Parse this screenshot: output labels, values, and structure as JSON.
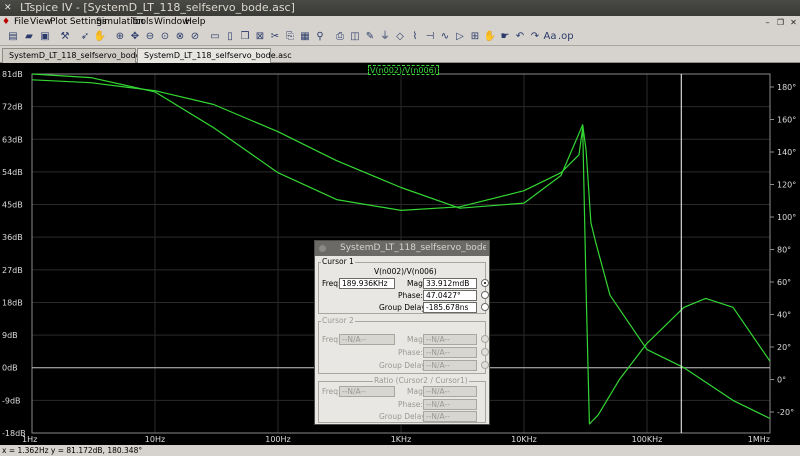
{
  "window": {
    "title": "LTspice IV - [SystemD_LT_118_selfservo_bode.asc]"
  },
  "menu": [
    "File",
    "View",
    "Plot Settings",
    "Simulation",
    "Tools",
    "Window",
    "Help"
  ],
  "tabs": [
    {
      "label": "SystemD_LT_118_selfservo_bode.asc",
      "active": false
    },
    {
      "label": "SystemD_LT_118_selfservo_bode.asc",
      "active": true
    }
  ],
  "plot": {
    "expression": "V(n002)/V(n006)",
    "colors": {
      "background": "#000000",
      "trace": "#33d633",
      "grid": "#2a2a2a",
      "axis_text": "#dcdcdc",
      "cursor": "#ffffff"
    },
    "left_ticks": [
      "81dB",
      "72dB",
      "63dB",
      "54dB",
      "45dB",
      "36dB",
      "27dB",
      "18dB",
      "9dB",
      "0dB",
      "-9dB",
      "-18dB"
    ],
    "right_ticks": [
      "180°",
      "160°",
      "140°",
      "120°",
      "100°",
      "80°",
      "60°",
      "40°",
      "20°",
      "0°",
      "-20°"
    ],
    "x_ticks": [
      "1Hz",
      "10Hz",
      "100Hz",
      "1KHz",
      "10KHz",
      "100KHz",
      "1MHz"
    ]
  },
  "chart_data": {
    "type": "line",
    "title": "V(n002)/V(n006)",
    "x_scale": "log",
    "xlim_hz": [
      1,
      1000000
    ],
    "ylim_left_db": [
      -18,
      81
    ],
    "ylim_right_deg": [
      -20,
      180
    ],
    "series": [
      {
        "name": "magnitude",
        "axis": "left",
        "unit": "dB",
        "x_hz": [
          1,
          3,
          10,
          30,
          100,
          300,
          1000,
          3000,
          10000,
          20000,
          30000,
          32000,
          35000,
          38000,
          50000,
          100000,
          200000,
          500000,
          1000000
        ],
        "y": [
          79.4,
          78.6,
          76.4,
          72.6,
          65.1,
          57.1,
          49.7,
          44.0,
          45.4,
          53.0,
          67.0,
          60.0,
          40.0,
          35.0,
          20.0,
          5.0,
          0.0,
          -9.0,
          -14.0
        ]
      },
      {
        "name": "phase",
        "axis": "right",
        "unit": "deg",
        "x_hz": [
          1,
          3,
          10,
          30,
          100,
          300,
          1000,
          3000,
          10000,
          20000,
          28000,
          30000,
          32000,
          34000,
          40000,
          60000,
          100000,
          200000,
          300000,
          500000,
          1000000
        ],
        "y": [
          180,
          178,
          170,
          150,
          125,
          110,
          104,
          106,
          115,
          125,
          135,
          150,
          60,
          -15,
          -10,
          10,
          30,
          50,
          55,
          50,
          20
        ]
      }
    ],
    "cursor_x_hz": 189936
  },
  "cursor_dialog": {
    "title": "SystemD_LT_118_selfservo_bode",
    "cursor1": {
      "label": "Cursor 1",
      "expr": "V(n002)/V(n006)",
      "freq_label": "Freq:",
      "freq": "189.936KHz",
      "mag_label": "Mag:",
      "mag": "33.912mdB",
      "phase_label": "Phase:",
      "phase": "47.0427°",
      "gd_label": "Group Delay:",
      "gd": "-185.678ns"
    },
    "cursor2": {
      "label": "Cursor 2",
      "freq_label": "Freq:",
      "freq": "--N/A--",
      "mag_label": "Mag:",
      "mag": "--N/A--",
      "phase_label": "Phase:",
      "phase": "--N/A--",
      "gd_label": "Group Delay:",
      "gd": "--N/A--"
    },
    "ratio": {
      "label": "Ratio (Cursor2 / Cursor1)",
      "freq_label": "Freq:",
      "freq": "--N/A--",
      "mag_label": "Mag:",
      "mag": "--N/A--",
      "phase_label": "Phase:",
      "phase": "--N/A--",
      "gd_label": "Group Delay:",
      "gd": "--N/A--"
    }
  },
  "status": {
    "text": "x = 1.362Hz    y = 81.172dB, 180.348°"
  }
}
